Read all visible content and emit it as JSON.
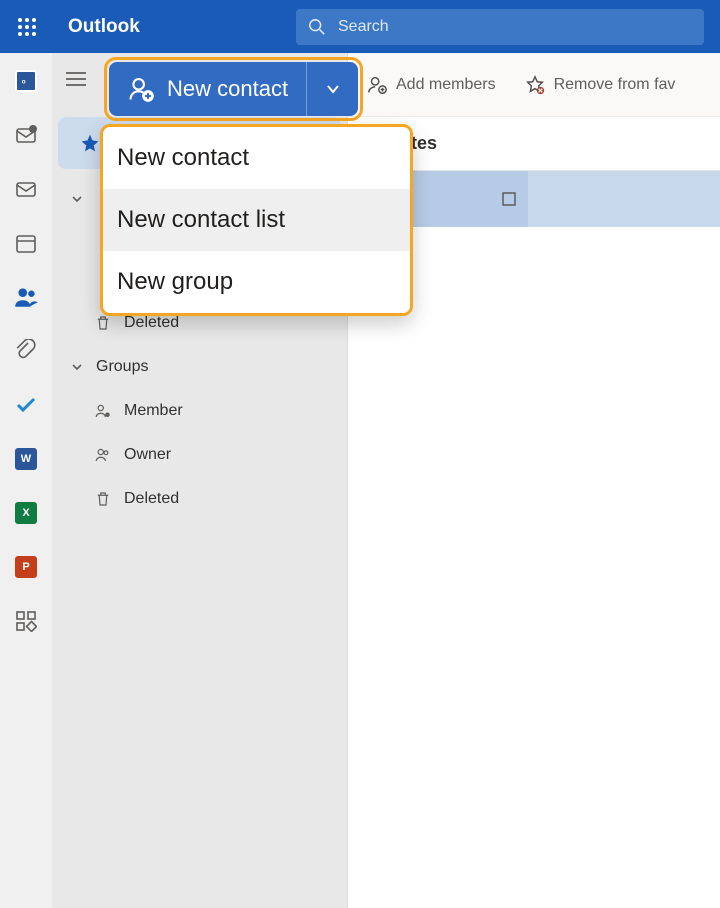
{
  "header": {
    "title": "Outlook",
    "search_placeholder": "Search"
  },
  "new_contact": {
    "label": "New contact"
  },
  "dropdown": {
    "items": [
      "New contact",
      "New contact list",
      "New group"
    ]
  },
  "toolbar": {
    "add_members": "Add members",
    "remove_fav": "Remove from fav"
  },
  "content": {
    "favorites_header": "avorites"
  },
  "sidebar": {
    "deleted1": "Deleted",
    "groups": "Groups",
    "member": "Member",
    "owner": "Owner",
    "deleted2": "Deleted"
  },
  "rail_icons": {
    "outlook": "O",
    "word": "W",
    "excel": "X",
    "ppt": "P"
  }
}
